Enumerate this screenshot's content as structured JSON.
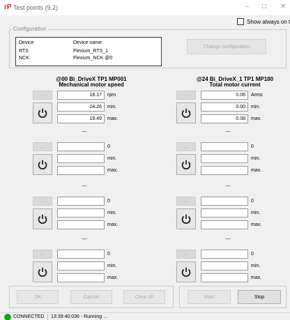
{
  "window": {
    "title": "Test points (9.2)",
    "app_icon": "rP",
    "minimize": "–",
    "maximize": "□",
    "close": "✕"
  },
  "always_on_top": {
    "label": "Show always on top",
    "checked": false
  },
  "configuration": {
    "legend": "Configuration",
    "headers": [
      "Device",
      "Device name"
    ],
    "rows": [
      [
        "RTS",
        "Flexium_RTS_1"
      ],
      [
        "NCK",
        "Flexium_NCK @0"
      ]
    ],
    "change_button": "Change configuration"
  },
  "monitors": [
    {
      "title1": "@00 Bi_DriveX TP1 MP001",
      "title2": "Mechanical motor speed",
      "button": "...",
      "value": "18.17",
      "unit": "rpm",
      "min": "-24.26",
      "min_label": "min.",
      "max": "19.49",
      "max_label": "max."
    },
    {
      "title1": "@24 Bi_DriveX_1 TP1 MP180",
      "title2": "Total motor current",
      "button": "...",
      "value": "0.06",
      "unit": "Arms",
      "min": "0.00",
      "min_label": "min.",
      "max": "0.08",
      "max_label": "max."
    },
    {
      "title1": "---",
      "button": "...",
      "value": "",
      "unit": "0",
      "min": "",
      "min_label": "min.",
      "max": "",
      "max_label": "max."
    },
    {
      "title1": "---",
      "button": "...",
      "value": "",
      "unit": "0",
      "min": "",
      "min_label": "min.",
      "max": "",
      "max_label": "max."
    },
    {
      "title1": "---",
      "button": "...",
      "value": "",
      "unit": "0",
      "min": "",
      "min_label": "min.",
      "max": "",
      "max_label": "max."
    },
    {
      "title1": "---",
      "button": "...",
      "value": "",
      "unit": "0",
      "min": "",
      "min_label": "min.",
      "max": "",
      "max_label": "max."
    },
    {
      "title1": "---",
      "button": "...",
      "value": "",
      "unit": "0",
      "min": "",
      "min_label": "min.",
      "max": "",
      "max_label": "max."
    },
    {
      "title1": "---",
      "button": "...",
      "value": "",
      "unit": "0",
      "min": "",
      "min_label": "min.",
      "max": "",
      "max_label": "max."
    }
  ],
  "buttons": {
    "ok": "OK",
    "cancel": "Cancel",
    "clear_all": "Clear All",
    "start": "Start",
    "stop": "Stop"
  },
  "status": {
    "connection": "CONNECTED",
    "time": "13:39:40:036 - Running ...",
    "color": "#14a814"
  }
}
